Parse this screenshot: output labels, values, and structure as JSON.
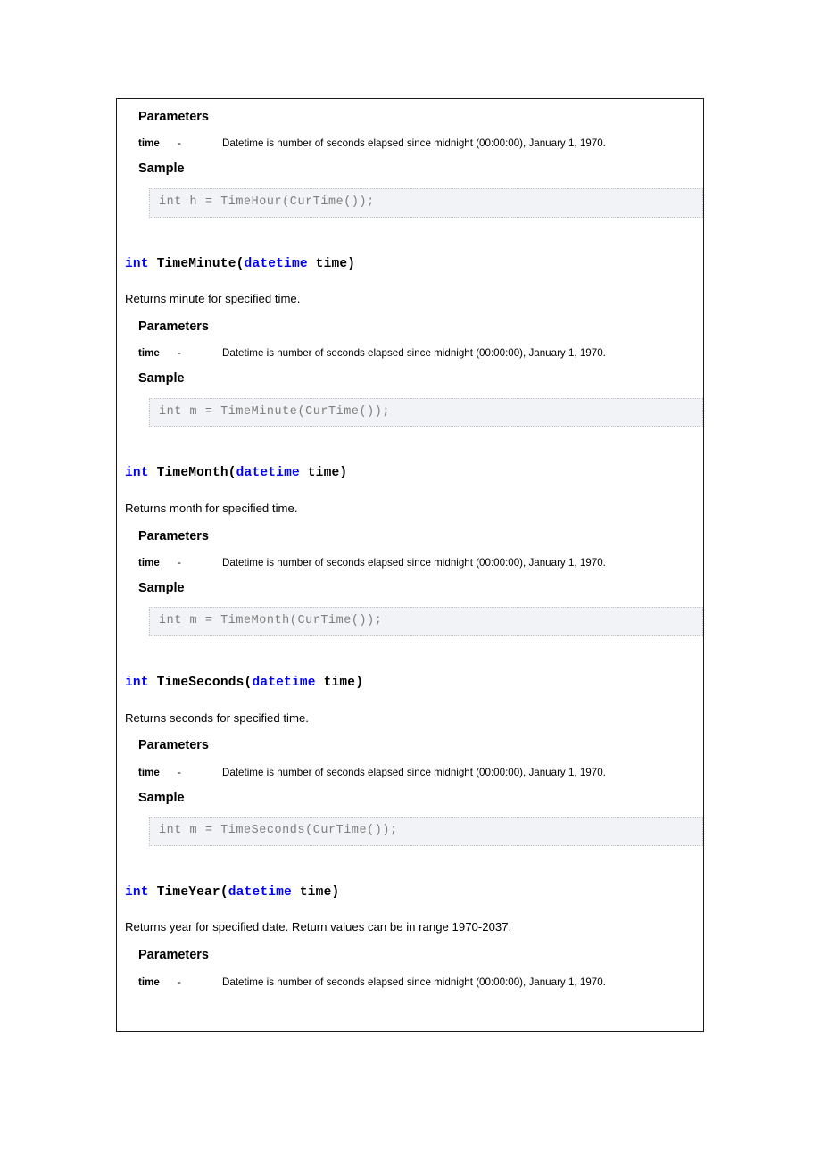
{
  "document": {
    "type": "api-reference",
    "shared": {
      "param_name": "time",
      "param_dash": "-",
      "param_description": "Datetime is number of seconds elapsed since midnight (00:00:00), January 1, 1970.",
      "parameters_heading": "Parameters",
      "sample_heading": "Sample",
      "keyword_color": "#0000ff",
      "code_text_color": "#7e7e7e",
      "code_bg_color": "#f1f3f6",
      "frame_border_color": "#1a1a1a"
    },
    "top_partial_section": {
      "parameters_heading": "Parameters",
      "param_name": "time",
      "param_dash": "-",
      "param_description": "Datetime is number of seconds elapsed since midnight (00:00:00), January 1, 1970.",
      "sample_heading": "Sample",
      "code": "int h = TimeHour(CurTime());"
    },
    "functions": [
      {
        "return_type": "int",
        "name": "TimeMinute",
        "open_paren": "(",
        "arg_type": "datetime",
        "arg_name": " time",
        "close_paren": ")",
        "description": "Returns minute for specified time.",
        "parameters_heading": "Parameters",
        "param_name": "time",
        "param_dash": "-",
        "param_description": "Datetime is number of seconds elapsed since midnight (00:00:00), January 1, 1970.",
        "sample_heading": "Sample",
        "code": "int m = TimeMinute(CurTime());"
      },
      {
        "return_type": "int",
        "name": "TimeMonth",
        "open_paren": "(",
        "arg_type": "datetime",
        "arg_name": " time",
        "close_paren": ")",
        "description": "Returns month for specified time.",
        "parameters_heading": "Parameters",
        "param_name": "time",
        "param_dash": "-",
        "param_description": "Datetime is number of seconds elapsed since midnight (00:00:00), January 1, 1970.",
        "sample_heading": "Sample",
        "code": "int m = TimeMonth(CurTime());"
      },
      {
        "return_type": "int",
        "name": "TimeSeconds",
        "open_paren": "(",
        "arg_type": "datetime",
        "arg_name": " time",
        "close_paren": ")",
        "description": "Returns seconds for specified time.",
        "parameters_heading": "Parameters",
        "param_name": "time",
        "param_dash": "-",
        "param_description": "Datetime is number of seconds elapsed since midnight (00:00:00), January 1, 1970.",
        "sample_heading": "Sample",
        "code": "int m = TimeSeconds(CurTime());"
      },
      {
        "return_type": "int",
        "name": "TimeYear",
        "open_paren": "(",
        "arg_type": "datetime",
        "arg_name": " time",
        "close_paren": ")",
        "description": "Returns year for specified date. Return values can be in range 1970-2037.",
        "parameters_heading": "Parameters",
        "param_name": "time",
        "param_dash": "-",
        "param_description": "Datetime is number of seconds elapsed since midnight (00:00:00), January 1, 1970.",
        "sample_heading": null,
        "code": null
      }
    ]
  }
}
